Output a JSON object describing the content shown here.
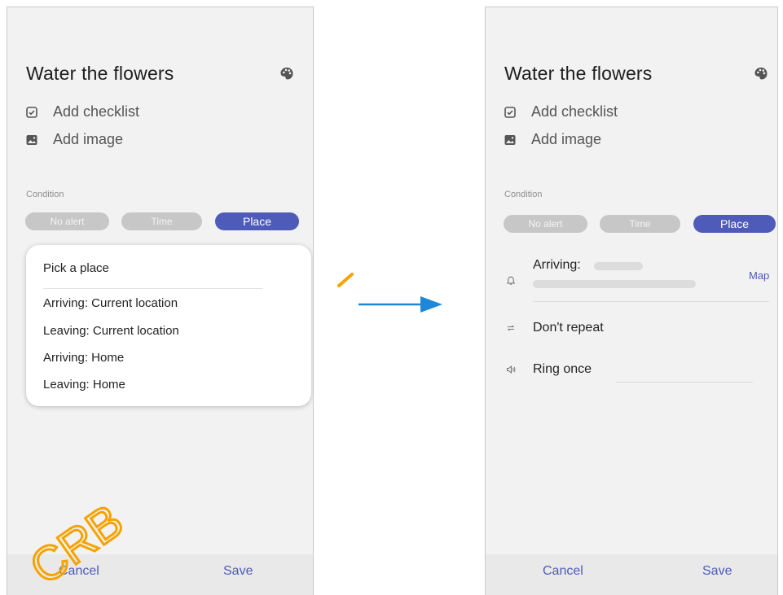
{
  "left_screen": {
    "title": "Water the flowers",
    "options": [
      {
        "icon": "checklist-icon",
        "label": "Add checklist"
      },
      {
        "icon": "image-icon",
        "label": "Add image"
      }
    ],
    "condition_label": "Condition",
    "chips": [
      {
        "label": "No alert",
        "active": false
      },
      {
        "label": "Time",
        "active": false
      },
      {
        "label": "Place",
        "active": true
      }
    ],
    "dropdown": {
      "header": "Pick a place",
      "items": [
        "Arriving: Current location",
        "Leaving: Current location",
        "Arriving: Home",
        "Leaving: Home"
      ]
    },
    "cancel_label": "Cancel",
    "save_label": "Save"
  },
  "right_screen": {
    "title": "Water the flowers",
    "options": [
      {
        "icon": "checklist-icon",
        "label": "Add checklist"
      },
      {
        "icon": "image-icon",
        "label": "Add image"
      }
    ],
    "condition_label": "Condition",
    "chips": [
      {
        "label": "No alert",
        "active": false
      },
      {
        "label": "Time",
        "active": false
      },
      {
        "label": "Place",
        "active": true
      }
    ],
    "arriving_label": "Arriving:",
    "map_label": "Map",
    "repeat_label": "Don't repeat",
    "ring_label": "Ring once",
    "cancel_label": "Cancel",
    "save_label": "Save"
  },
  "watermark_text": "CRB",
  "colors": {
    "accent": "#4e5bb8",
    "arrow": "#1e88d6",
    "watermark": "#f5a300",
    "chip_inactive": "#c7c7c7"
  }
}
